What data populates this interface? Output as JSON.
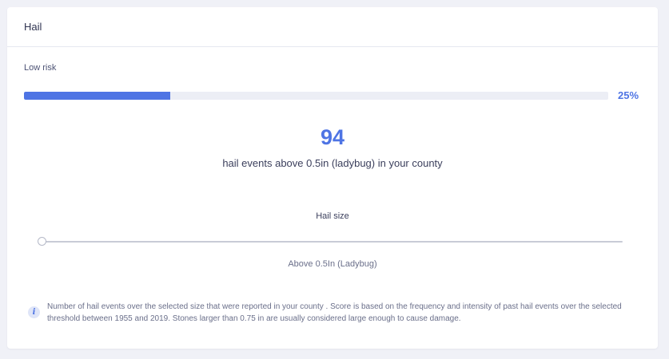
{
  "card": {
    "title": "Hail"
  },
  "risk": {
    "label": "Low risk",
    "percent_text": "25%",
    "fraction": 0.25
  },
  "events": {
    "count": "94",
    "caption": "hail events above 0.5in (ladybug) in your county"
  },
  "hail_size": {
    "label": "Hail size",
    "selected_value": "Above 0.5In (Ladybug)",
    "position_fraction": 0.0
  },
  "info": {
    "icon": "info-icon",
    "text": "Number of hail events over the selected size that were reported in your county . Score is based on the frequency and intensity of past hail events over the selected threshold between 1955 and 2019. Stones larger than 0.75 in are usually considered large enough to cause damage."
  },
  "colors": {
    "accent": "#4e74e4",
    "track": "#eceef5",
    "background": "#f0f1f7"
  }
}
